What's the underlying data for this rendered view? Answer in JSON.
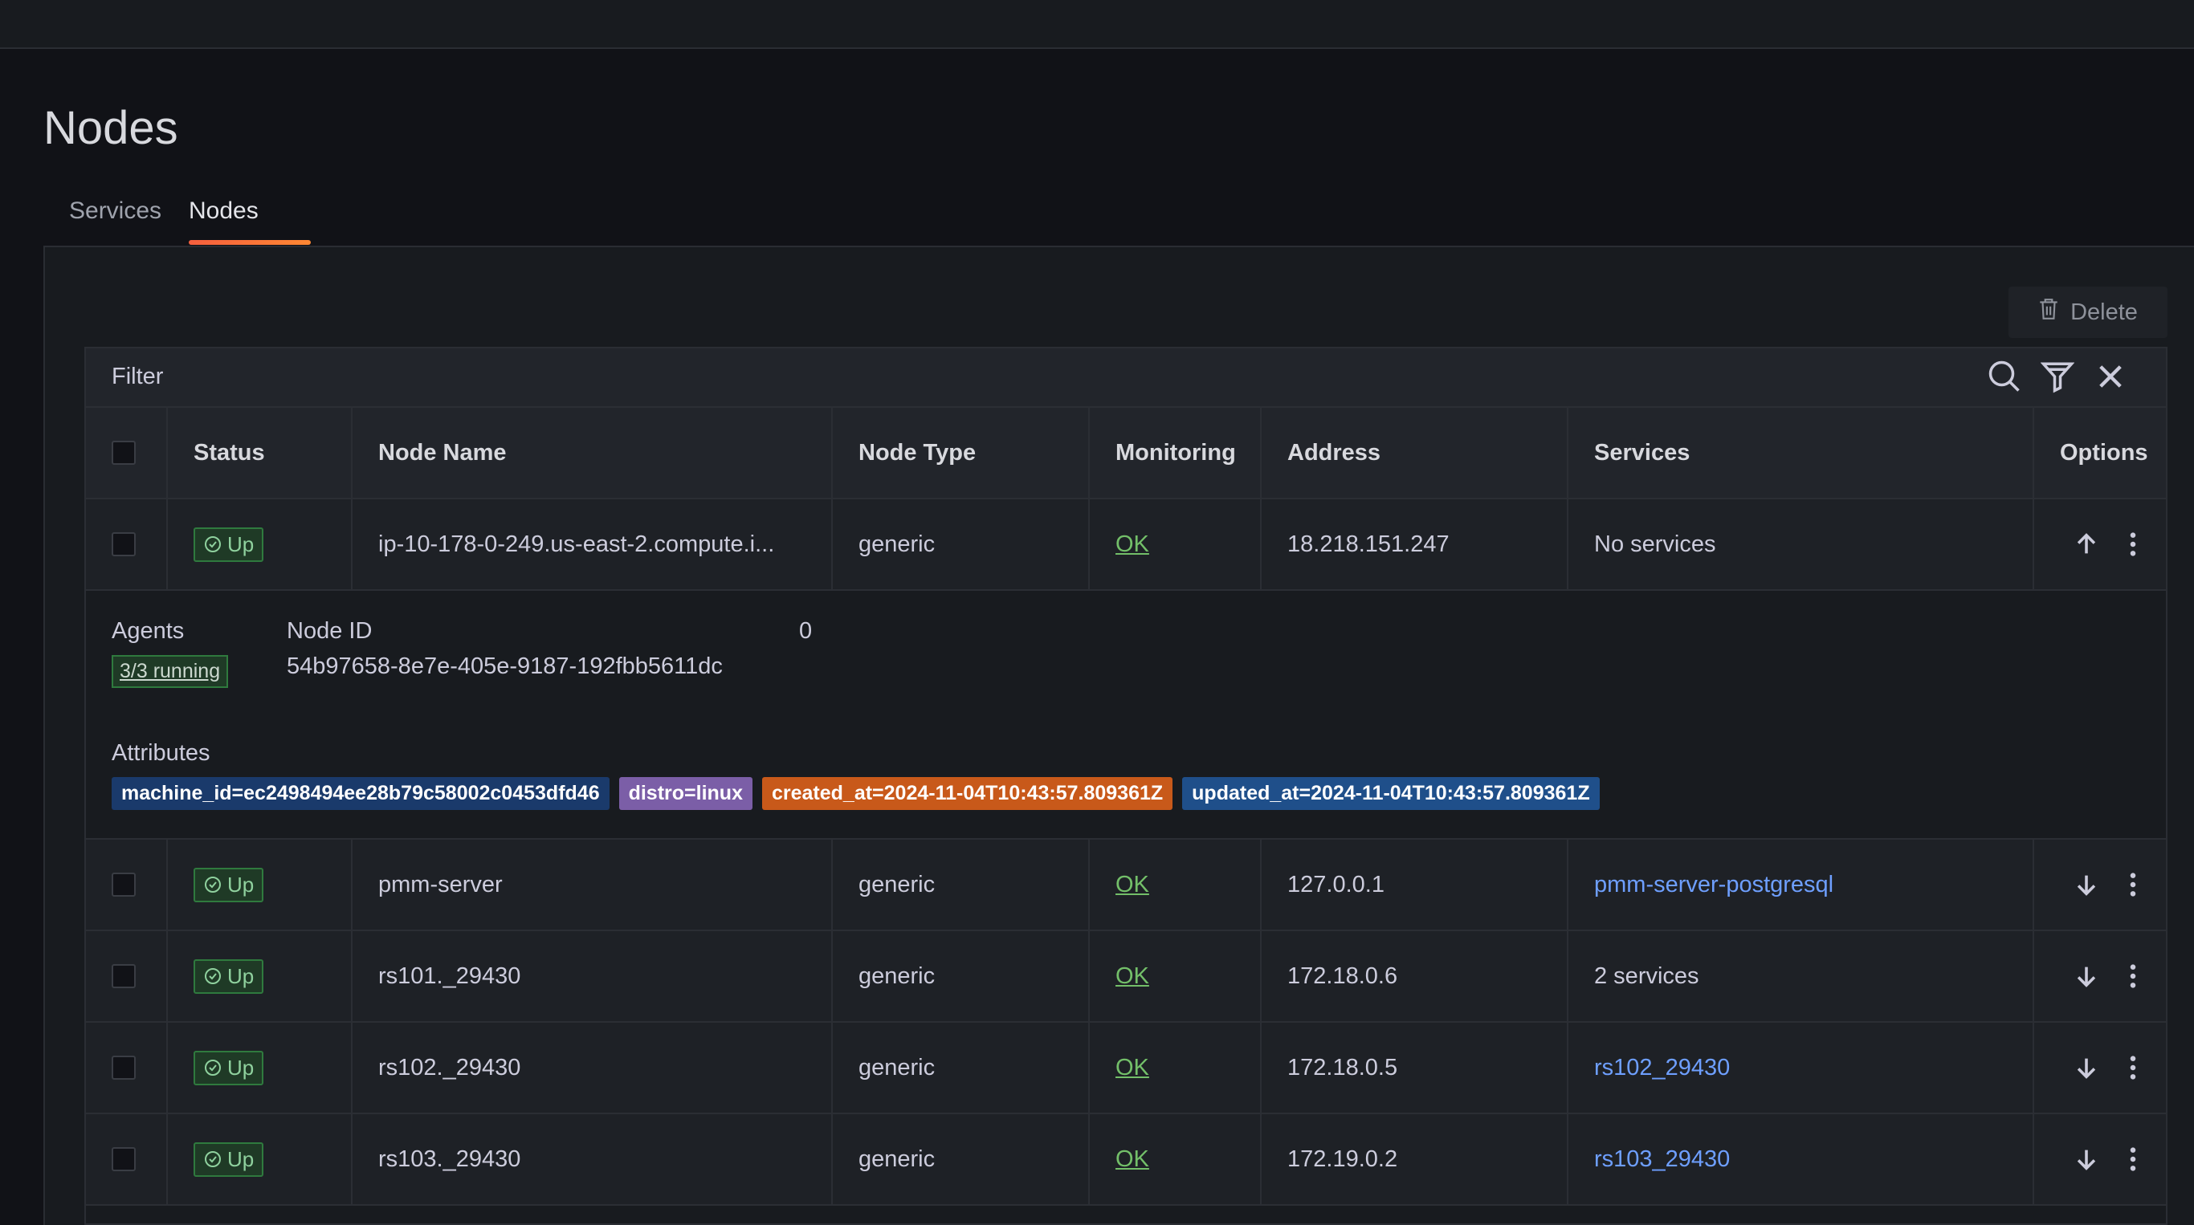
{
  "page": {
    "title": "Nodes"
  },
  "tabs": [
    {
      "label": "Services"
    },
    {
      "label": "Nodes"
    }
  ],
  "toolbar": {
    "delete_label": "Delete"
  },
  "filter": {
    "label": "Filter"
  },
  "table": {
    "headers": [
      "Status",
      "Node Name",
      "Node Type",
      "Monitoring",
      "Address",
      "Services",
      "Options"
    ],
    "rows": [
      {
        "status": "Up",
        "name": "ip-10-178-0-249.us-east-2.compute.i...",
        "type": "generic",
        "monitoring": "OK",
        "address": "18.218.151.247",
        "services": "No services",
        "services_link": false
      },
      {
        "status": "Up",
        "name": "pmm-server",
        "type": "generic",
        "monitoring": "OK",
        "address": "127.0.0.1",
        "services": "pmm-server-postgresql",
        "services_link": true
      },
      {
        "status": "Up",
        "name": "rs101._29430",
        "type": "generic",
        "monitoring": "OK",
        "address": "172.18.0.6",
        "services": "2 services",
        "services_link": false
      },
      {
        "status": "Up",
        "name": "rs102._29430",
        "type": "generic",
        "monitoring": "OK",
        "address": "172.18.0.5",
        "services": "rs102_29430",
        "services_link": true
      },
      {
        "status": "Up",
        "name": "rs103._29430",
        "type": "generic",
        "monitoring": "OK",
        "address": "172.19.0.2",
        "services": "rs103_29430",
        "services_link": true
      }
    ]
  },
  "expanded": {
    "agents_label": "Agents",
    "agents_value": "3/3 running",
    "node_id_label": "Node ID",
    "node_id_value": "54b97658-8e7e-405e-9187-192fbb5611dc",
    "extra_value": "0",
    "attributes_label": "Attributes",
    "attributes": [
      {
        "text": "machine_id=ec2498494ee28b79c58002c0453dfd46",
        "color": "#1a3a6b"
      },
      {
        "text": "distro=linux",
        "color": "#7b5ea7"
      },
      {
        "text": "created_at=2024-11-04T10:43:57.809361Z",
        "color": "#c8591a"
      },
      {
        "text": "updated_at=2024-11-04T10:43:57.809361Z",
        "color": "#1f4f8a"
      }
    ]
  },
  "colors": {
    "accent": "#f55f3e",
    "ok": "#73bf69",
    "link": "#6e9fff"
  }
}
